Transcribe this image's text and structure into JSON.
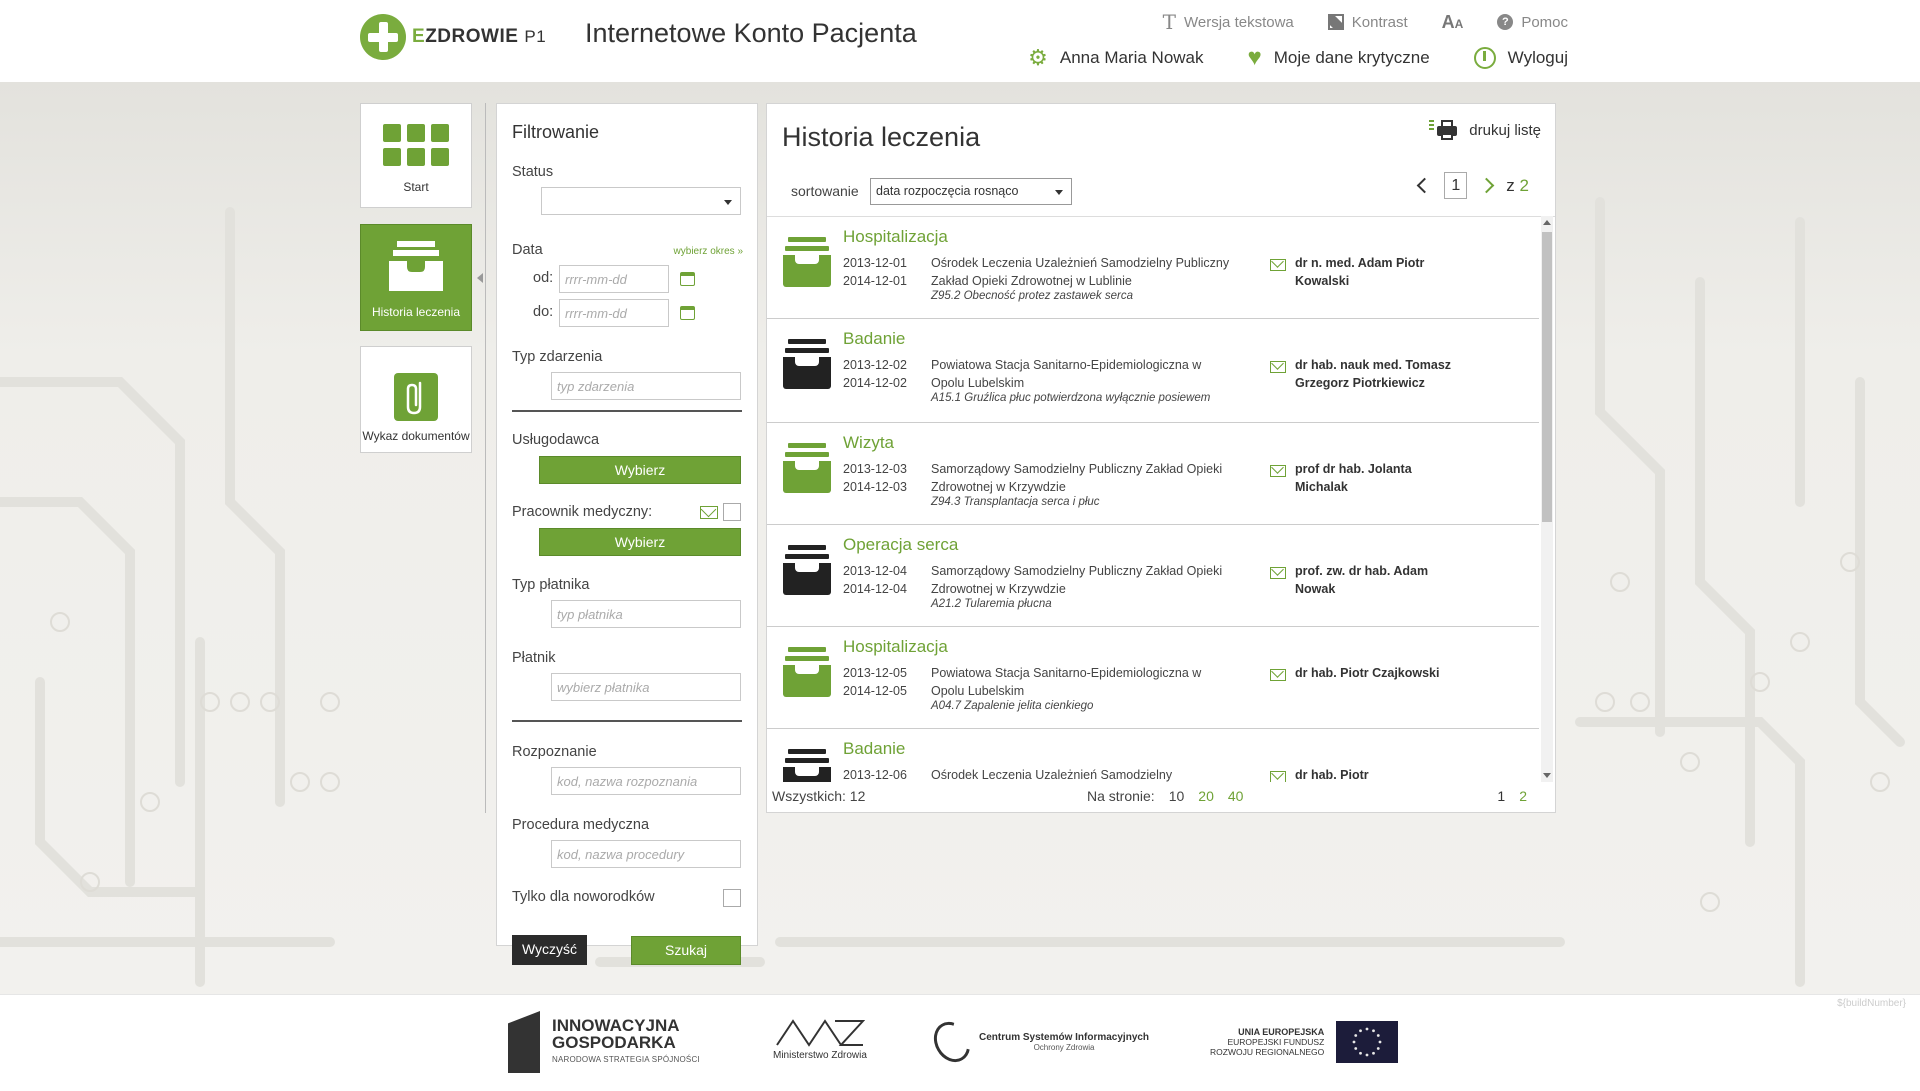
{
  "header": {
    "logo_brand_e": "E",
    "logo_brand_rest": "ZDROWIE",
    "logo_p1": "P1",
    "app_title": "Internetowe Konto Pacjenta",
    "top_links": {
      "text_version": "Wersja tekstowa",
      "contrast": "Kontrast",
      "font_size": "A",
      "font_size_small": "A",
      "help": "Pomoc",
      "help_glyph": "?"
    },
    "user_name": "Anna Maria Nowak",
    "critical_data": "Moje dane krytyczne",
    "logout": "Wyloguj",
    "icon_gear": "⚙",
    "icon_heart": "♥"
  },
  "nav": {
    "start": "Start",
    "history": "Historia leczenia",
    "documents": "Wykaz dokumentów"
  },
  "filter": {
    "title": "Filtrowanie",
    "status_label": "Status",
    "status_value": "",
    "date_label": "Data",
    "choose_period": "wybierz okres »",
    "from_label": "od:",
    "to_label": "do:",
    "date_placeholder": "rrrr-mm-dd",
    "event_type_label": "Typ zdarzenia",
    "event_type_placeholder": "typ zdarzenia",
    "provider_label": "Usługodawca",
    "choose_button": "Wybierz",
    "medical_worker_label": "Pracownik medyczny:",
    "payer_type_label": "Typ płatnika",
    "payer_type_placeholder": "typ płatnika",
    "payer_label": "Płatnik",
    "payer_placeholder": "wybierz płatnika",
    "diagnosis_label": "Rozpoznanie",
    "diagnosis_placeholder": "kod, nazwa rozpoznania",
    "procedure_label": "Procedura medyczna",
    "procedure_placeholder": "kod, nazwa procedury",
    "newborns_label": "Tylko dla noworodków",
    "clear_button": "Wyczyść",
    "search_button": "Szukaj"
  },
  "main": {
    "title": "Historia leczenia",
    "print_label": "drukuj listę",
    "sort_label": "sortowanie",
    "sort_value": "data rozpoczęcia rosnąco",
    "current_page": "1",
    "of_label": "z",
    "total_pages": "2",
    "items": [
      {
        "type": "Hospitalizacja",
        "icon": "green",
        "start": "2013-12-01",
        "end": "2014-12-01",
        "place": "Ośrodek Leczenia Uzależnień Samodzielny Publiczny Zakład Opieki Zdrowotnej w Lublinie",
        "diagnosis": "Z95.2 Obecność protez zastawek serca",
        "doctor": "dr n. med. Adam Piotr Kowalski"
      },
      {
        "type": "Badanie",
        "icon": "dark",
        "start": "2013-12-02",
        "end": "2014-12-02",
        "place": "Powiatowa Stacja Sanitarno-Epidemiologiczna w Opolu Lubelskim",
        "diagnosis": "A15.1 Gruźlica płuc potwierdzona wyłącznie posiewem",
        "doctor": "dr hab. nauk med. Tomasz Grzegorz Piotrkiewicz"
      },
      {
        "type": "Wizyta",
        "icon": "green",
        "start": "2013-12-03",
        "end": "2014-12-03",
        "place": "Samorządowy Samodzielny Publiczny Zakład Opieki Zdrowotnej w Krzywdzie",
        "diagnosis": "Z94.3 Transplantacja serca i płuc",
        "doctor": "prof dr hab. Jolanta Michalak"
      },
      {
        "type": "Operacja serca",
        "icon": "dark",
        "start": "2013-12-04",
        "end": "2014-12-04",
        "place": "Samorządowy Samodzielny Publiczny Zakład Opieki Zdrowotnej w Krzywdzie",
        "diagnosis": "A21.2 Tularemia płucna",
        "doctor": "prof. zw. dr hab. Adam Nowak"
      },
      {
        "type": "Hospitalizacja",
        "icon": "green",
        "start": "2013-12-05",
        "end": "2014-12-05",
        "place": "Powiatowa Stacja Sanitarno-Epidemiologiczna w Opolu Lubelskim",
        "diagnosis": "A04.7 Zapalenie jelita cienkiego",
        "doctor": "dr hab. Piotr Czajkowski"
      },
      {
        "type": "Badanie",
        "icon": "dark",
        "start": "2013-12-06",
        "end": "",
        "place": "Ośrodek Leczenia Uzależnień Samodzielny",
        "diagnosis": "",
        "doctor": "dr hab. Piotr"
      }
    ],
    "total_label": "Wszystkich: 12",
    "per_page_label": "Na stronie:",
    "per_page_options": [
      "10",
      "20",
      "40"
    ],
    "pages": [
      "1",
      "2"
    ]
  },
  "footer": {
    "build": "${buildNumber}",
    "ig_line1": "INNOWACYJNA",
    "ig_line2": "GOSPODARKA",
    "ig_sub": "NARODOWA STRATEGIA SPÓJNOŚCI",
    "mz_logo": "MZ",
    "mz": "Ministerstwo Zdrowia",
    "csi_title": "Centrum Systemów Informacyjnych",
    "csi_sub": "Ochrony Zdrowia",
    "ue_line1": "UNIA EUROPEJSKA",
    "ue_line2": "EUROPEJSKI FUNDUSZ",
    "ue_line3": "ROZWOJU REGIONALNEGO"
  },
  "colors": {
    "accent": "#6fa236",
    "dark": "#222222"
  }
}
